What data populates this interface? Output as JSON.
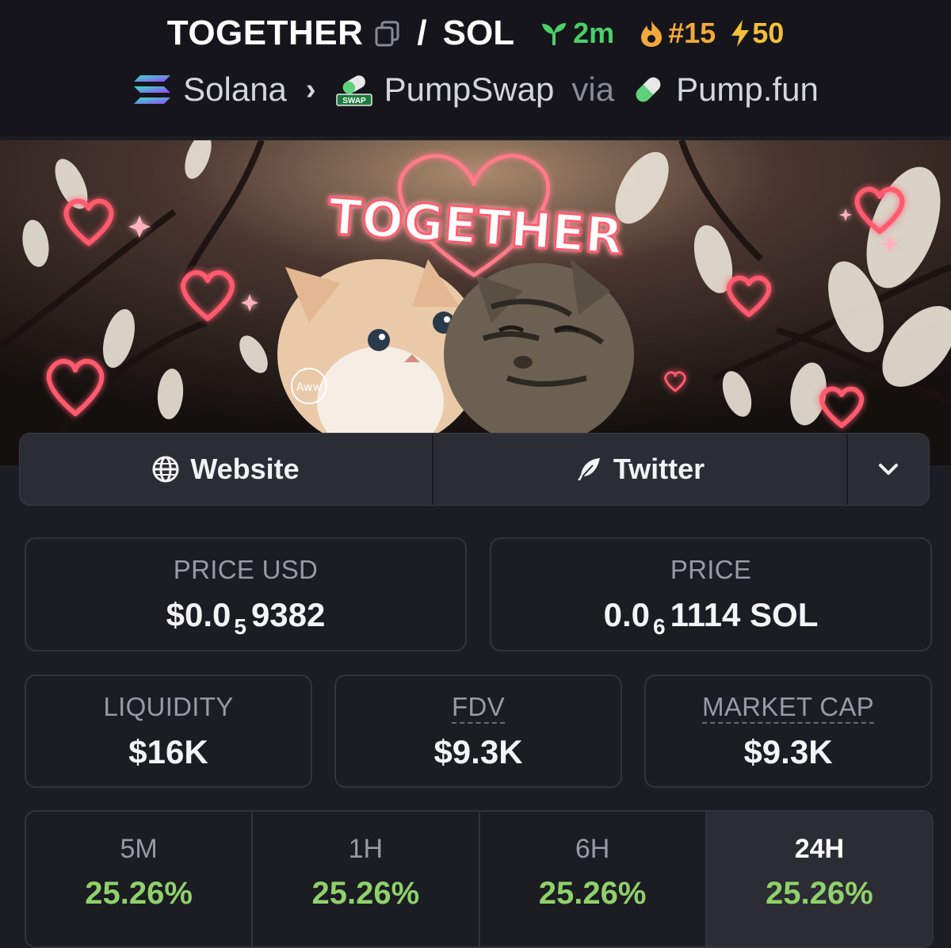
{
  "header": {
    "token_symbol": "TOGETHER",
    "separator": "/",
    "quote_symbol": "SOL",
    "age": "2m",
    "rank": "#15",
    "boost": "50",
    "chain": "Solana",
    "dex": "PumpSwap",
    "dex_badge": "SWAP",
    "via_label": "via",
    "launchpad": "Pump.fun"
  },
  "banner": {
    "title": "TOGETHER",
    "stamp": "Aww"
  },
  "links": {
    "website_label": "Website",
    "twitter_label": "Twitter"
  },
  "stats": {
    "price_usd": {
      "label": "PRICE USD",
      "prefix": "$0.0",
      "zeros": "5",
      "digits": "9382"
    },
    "price": {
      "label": "PRICE",
      "prefix": "0.0",
      "zeros": "6",
      "digits": "1114 SOL"
    },
    "liquidity": {
      "label": "LIQUIDITY",
      "value": "$16K"
    },
    "fdv": {
      "label": "FDV",
      "value": "$9.3K"
    },
    "market_cap": {
      "label": "MARKET CAP",
      "value": "$9.3K"
    }
  },
  "timeframes": [
    {
      "label": "5M",
      "change": "25.26%"
    },
    {
      "label": "1H",
      "change": "25.26%"
    },
    {
      "label": "6H",
      "change": "25.26%"
    },
    {
      "label": "24H",
      "change": "25.26%",
      "selected": true
    }
  ],
  "colors": {
    "accent_green": "#8fd16a",
    "age_green": "#4ccf6a",
    "rank_orange": "#f2a93a",
    "boost_yellow": "#f2c03a",
    "background": "#1c1c23"
  }
}
